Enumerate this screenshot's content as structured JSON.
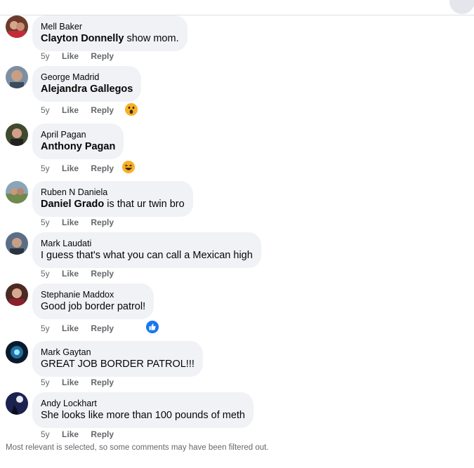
{
  "comments": [
    {
      "author": "Mell Baker",
      "tag": "Clayton Donnelly",
      "text": " show mom.",
      "time": "5y",
      "like": "Like",
      "reply": "Reply"
    },
    {
      "author": "George Madrid",
      "tag": "Alejandra Gallegos",
      "text": "",
      "time": "5y",
      "like": "Like",
      "reply": "Reply",
      "reaction": "wow-icon"
    },
    {
      "author": "April Pagan",
      "tag": "Anthony Pagan",
      "text": "",
      "time": "5y",
      "like": "Like",
      "reply": "Reply",
      "reaction": "haha-icon"
    },
    {
      "author": "Ruben N Daniela",
      "tag": "Daniel Grado",
      "text": " is that ur twin bro",
      "time": "5y",
      "like": "Like",
      "reply": "Reply"
    },
    {
      "author": "Mark Laudati",
      "tag": "",
      "text": "I guess that's what you can call a Mexican high",
      "time": "5y",
      "like": "Like",
      "reply": "Reply"
    },
    {
      "author": "Stephanie Maddox",
      "tag": "",
      "text": "Good job border patrol!",
      "time": "5y",
      "like": "Like",
      "reply": "Reply",
      "reaction": "like-icon"
    },
    {
      "author": "Mark Gaytan",
      "tag": "",
      "text": "GREAT JOB BORDER PATROL!!!",
      "time": "5y",
      "like": "Like",
      "reply": "Reply"
    },
    {
      "author": "Andy Lockhart",
      "tag": "",
      "text": "She looks like more than 100 pounds of meth",
      "time": "5y",
      "like": "Like",
      "reply": "Reply"
    }
  ],
  "footer": "Most relevant is selected, so some comments may have been filtered out.",
  "colors": {
    "bubble": "#f0f2f5",
    "meta": "#65676b",
    "like_blue": "#1877f2",
    "emoji_yellow": "#f7b125"
  }
}
